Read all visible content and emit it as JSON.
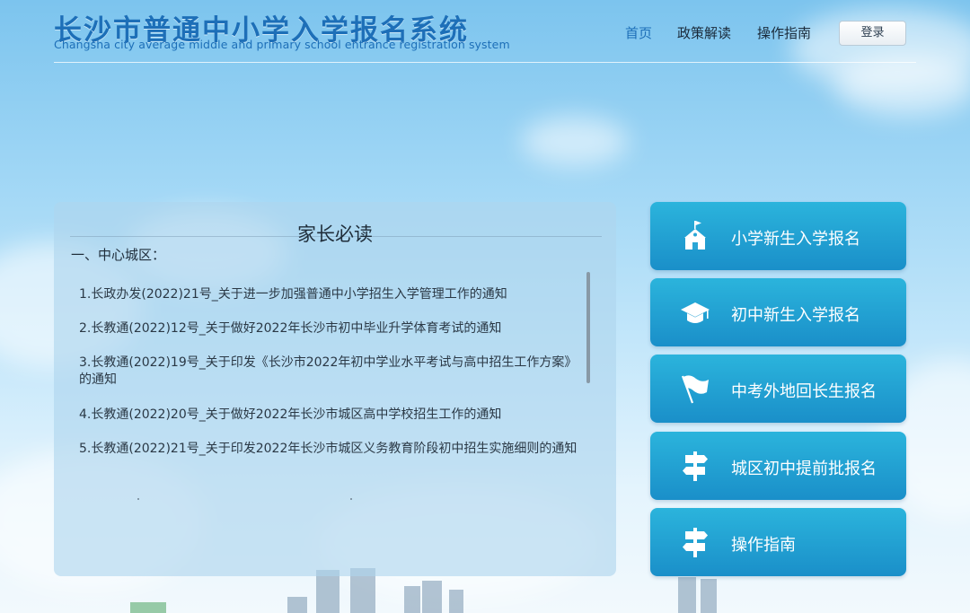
{
  "header": {
    "title": "长沙市普通中小学入学报名系统",
    "subtitle": "Changsha city average middle and primary school entrance registration system",
    "nav": [
      {
        "label": "首页"
      },
      {
        "label": "政策解读"
      },
      {
        "label": "操作指南"
      }
    ],
    "login_label": "登录"
  },
  "notice_panel": {
    "title": "家长必读",
    "section": "一、中心城区：",
    "items": [
      {
        "text": "1.长政办发(2022)21号_关于进一步加强普通中小学招生入学管理工作的通知"
      },
      {
        "text": "2.长教通(2022)12号_关于做好2022年长沙市初中毕业升学体育考试的通知"
      },
      {
        "text": "3.长教通(2022)19号_关于印发《长沙市2022年初中学业水平考试与高中招生工作方案》的通知"
      },
      {
        "text": "4.长教通(2022)20号_关于做好2022年长沙市城区高中学校招生工作的通知"
      },
      {
        "text": "5.长教通(2022)21号_关于印发2022年长沙市城区义务教育阶段初中招生实施细则的通知"
      }
    ]
  },
  "side_buttons": [
    {
      "label": "小学新生入学报名",
      "icon": "school-building-icon"
    },
    {
      "label": "初中新生入学报名",
      "icon": "graduation-cap-icon"
    },
    {
      "label": "中考外地回长生报名",
      "icon": "flag-icon"
    },
    {
      "label": "城区初中提前批报名",
      "icon": "signpost-icon"
    },
    {
      "label": "操作指南",
      "icon": "signpost-icon"
    }
  ],
  "colors": {
    "title_blue": "#1d6fb8",
    "button_gradient_top": "#2bb4dc",
    "button_gradient_bottom": "#1a8fc9"
  }
}
